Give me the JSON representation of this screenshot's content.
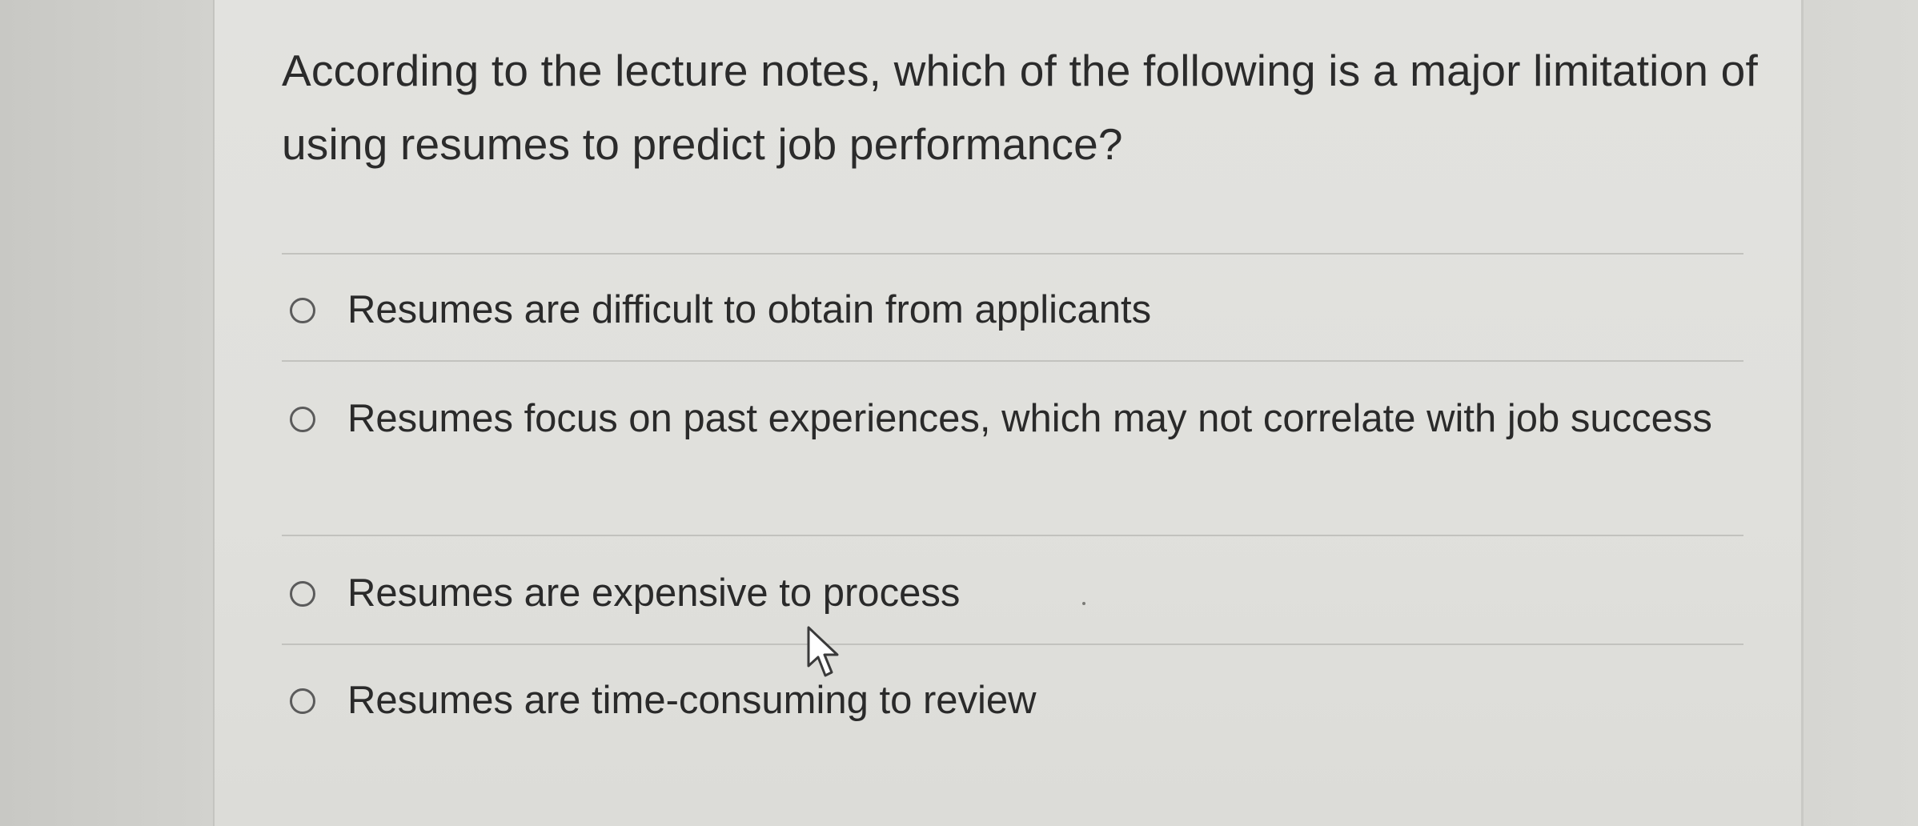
{
  "quiz": {
    "question": "According to the lecture notes, which of the following is a major limitation of using resumes to predict job performance?",
    "options": [
      {
        "label": "Resumes are difficult to obtain from applicants",
        "selected": false
      },
      {
        "label": "Resumes focus on past experiences, which may not correlate with job success",
        "selected": false
      },
      {
        "label": "Resumes are expensive to process",
        "selected": false
      },
      {
        "label": "Resumes are time-consuming to review",
        "selected": false
      }
    ]
  },
  "icons": {
    "radio": "radio-unselected-icon",
    "cursor": "mouse-pointer-icon"
  },
  "colors": {
    "text": "#2b2b2b",
    "radio_border": "#5b5b5b",
    "divider": "#c2c2be",
    "card_background": "#e1e1de"
  }
}
